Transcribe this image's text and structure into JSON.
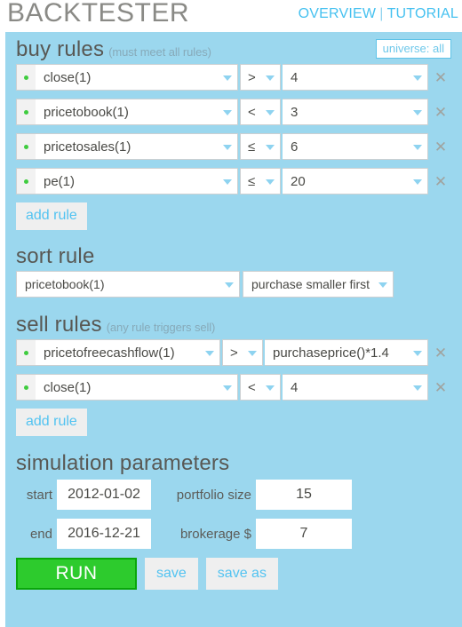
{
  "header": {
    "title": "BACKTESTER",
    "links": [
      {
        "label": "OVERVIEW"
      },
      {
        "label": "TUTORIAL"
      }
    ],
    "separator": "|"
  },
  "buy_rules": {
    "title": "buy rules",
    "note": "(must meet all rules)",
    "universe_badge": "universe: all",
    "add_rule_label": "add rule",
    "rows": [
      {
        "metric": "close(1)",
        "operator": ">",
        "value": "4"
      },
      {
        "metric": "pricetobook(1)",
        "operator": "<",
        "value": "3"
      },
      {
        "metric": "pricetosales(1)",
        "operator": "≤",
        "value": "6"
      },
      {
        "metric": "pe(1)",
        "operator": "≤",
        "value": "20"
      }
    ],
    "delete_label": "✕"
  },
  "sort_rule": {
    "title": "sort rule",
    "metric": "pricetobook(1)",
    "direction": "purchase smaller first"
  },
  "sell_rules": {
    "title": "sell rules",
    "note": "(any rule triggers sell)",
    "add_rule_label": "add rule",
    "rows": [
      {
        "metric": "pricetofreecashflow(1)",
        "operator": ">",
        "value": "purchaseprice()*1.4"
      },
      {
        "metric": "close(1)",
        "operator": "<",
        "value": "4"
      }
    ],
    "delete_label": "✕"
  },
  "simulation": {
    "title": "simulation parameters",
    "start_label": "start",
    "start_value": "2012-01-02",
    "end_label": "end",
    "end_value": "2016-12-21",
    "portfolio_label": "portfolio size",
    "portfolio_value": "15",
    "brokerage_label": "brokerage $",
    "brokerage_value": "7"
  },
  "actions": {
    "run_label": "RUN",
    "save_label": "save",
    "save_as_label": "save as"
  },
  "colors": {
    "panel_bg": "#9bd7ee",
    "accent_blue": "#52c3f1",
    "run_green": "#2dcb2d",
    "dot_green": "#3fcc3f",
    "title_gray": "#585854"
  }
}
